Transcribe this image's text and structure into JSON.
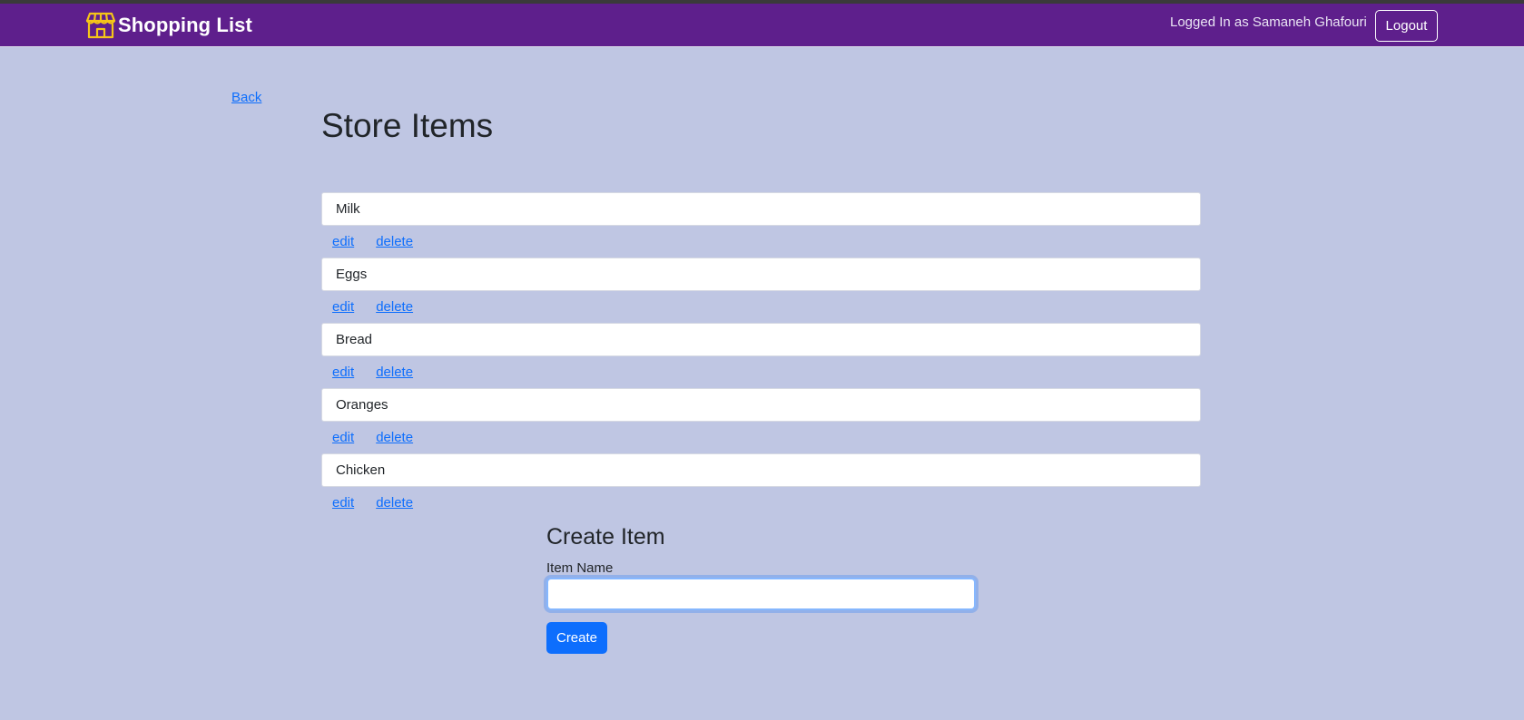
{
  "header": {
    "brand_icon": "storefront-icon",
    "brand_title": "Shopping List",
    "logged_in_text": "Logged In as Samaneh Ghafouri",
    "logout_label": "Logout",
    "colors": {
      "navbar": "#5e1f8c",
      "brand_icon": "#f5c518"
    }
  },
  "back_label": "Back",
  "page_title": "Store Items",
  "items": [
    {
      "name": "Milk",
      "edit_label": "edit",
      "delete_label": "delete"
    },
    {
      "name": "Eggs",
      "edit_label": "edit",
      "delete_label": "delete"
    },
    {
      "name": "Bread",
      "edit_label": "edit",
      "delete_label": "delete"
    },
    {
      "name": "Oranges",
      "edit_label": "edit",
      "delete_label": "delete"
    },
    {
      "name": "Chicken",
      "edit_label": "edit",
      "delete_label": "delete"
    }
  ],
  "create_form": {
    "title": "Create Item",
    "field_label": "Item Name",
    "field_value": "",
    "submit_label": "Create"
  },
  "colors": {
    "background": "#bfc6e3",
    "link": "#0d6efd",
    "primary_button": "#0d6efd"
  }
}
